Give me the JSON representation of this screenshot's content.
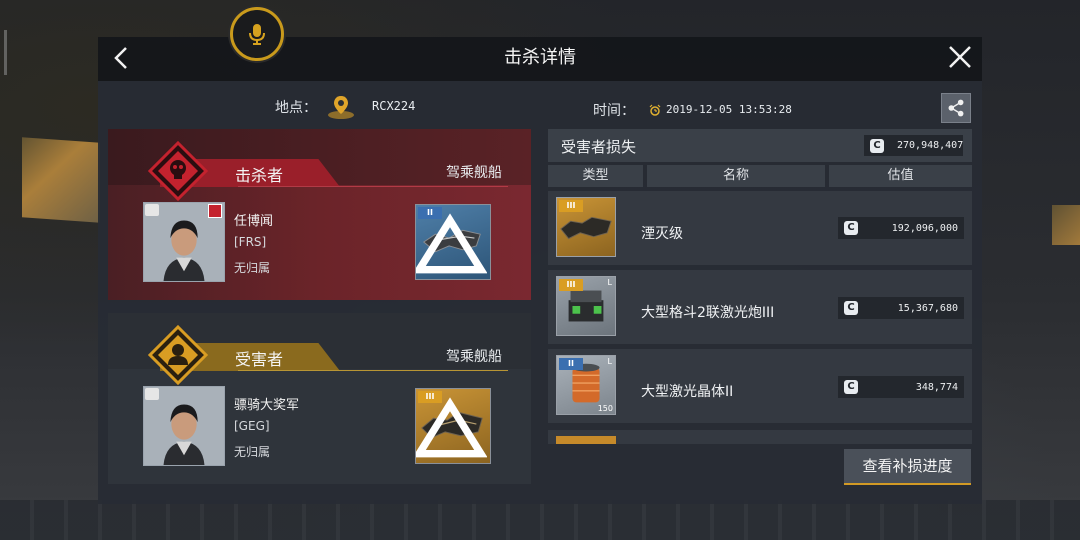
{
  "header": {
    "title": "击杀详情"
  },
  "info": {
    "location_label": "地点：",
    "location_value": "RCX224",
    "time_label": "时间：",
    "time_value": "2019-12-05 13:53:28"
  },
  "killer": {
    "role_label": "击杀者",
    "ship_heading": "驾乘舰船",
    "name": "任博闻",
    "corp": "[FRS]",
    "alliance": "无归属",
    "ship_tier": "II"
  },
  "victim": {
    "role_label": "受害者",
    "ship_heading": "驾乘舰船",
    "name": "骠骑大奖军",
    "corp": "[GEG]",
    "alliance": "无归属",
    "ship_tier": "III"
  },
  "losses": {
    "title": "受害者损失",
    "coin_symbol": "C",
    "total": "270,948,407",
    "columns": {
      "type": "类型",
      "name": "名称",
      "value": "估值"
    },
    "items": [
      {
        "name": "湮灭级",
        "value": "192,096,000",
        "tier": "III"
      },
      {
        "name": "大型格斗2联激光炮III",
        "value": "15,367,680",
        "tier": "III",
        "level": "L"
      },
      {
        "name": "大型激光晶体II",
        "value": "348,774",
        "tier": "II",
        "level": "L",
        "quantity": "150"
      }
    ]
  },
  "actions": {
    "progress_button": "查看补损进度"
  },
  "colors": {
    "accent_gold": "#d29a25",
    "killer_red": "#9a1f2a",
    "victim_gold": "#8a6a1e"
  }
}
